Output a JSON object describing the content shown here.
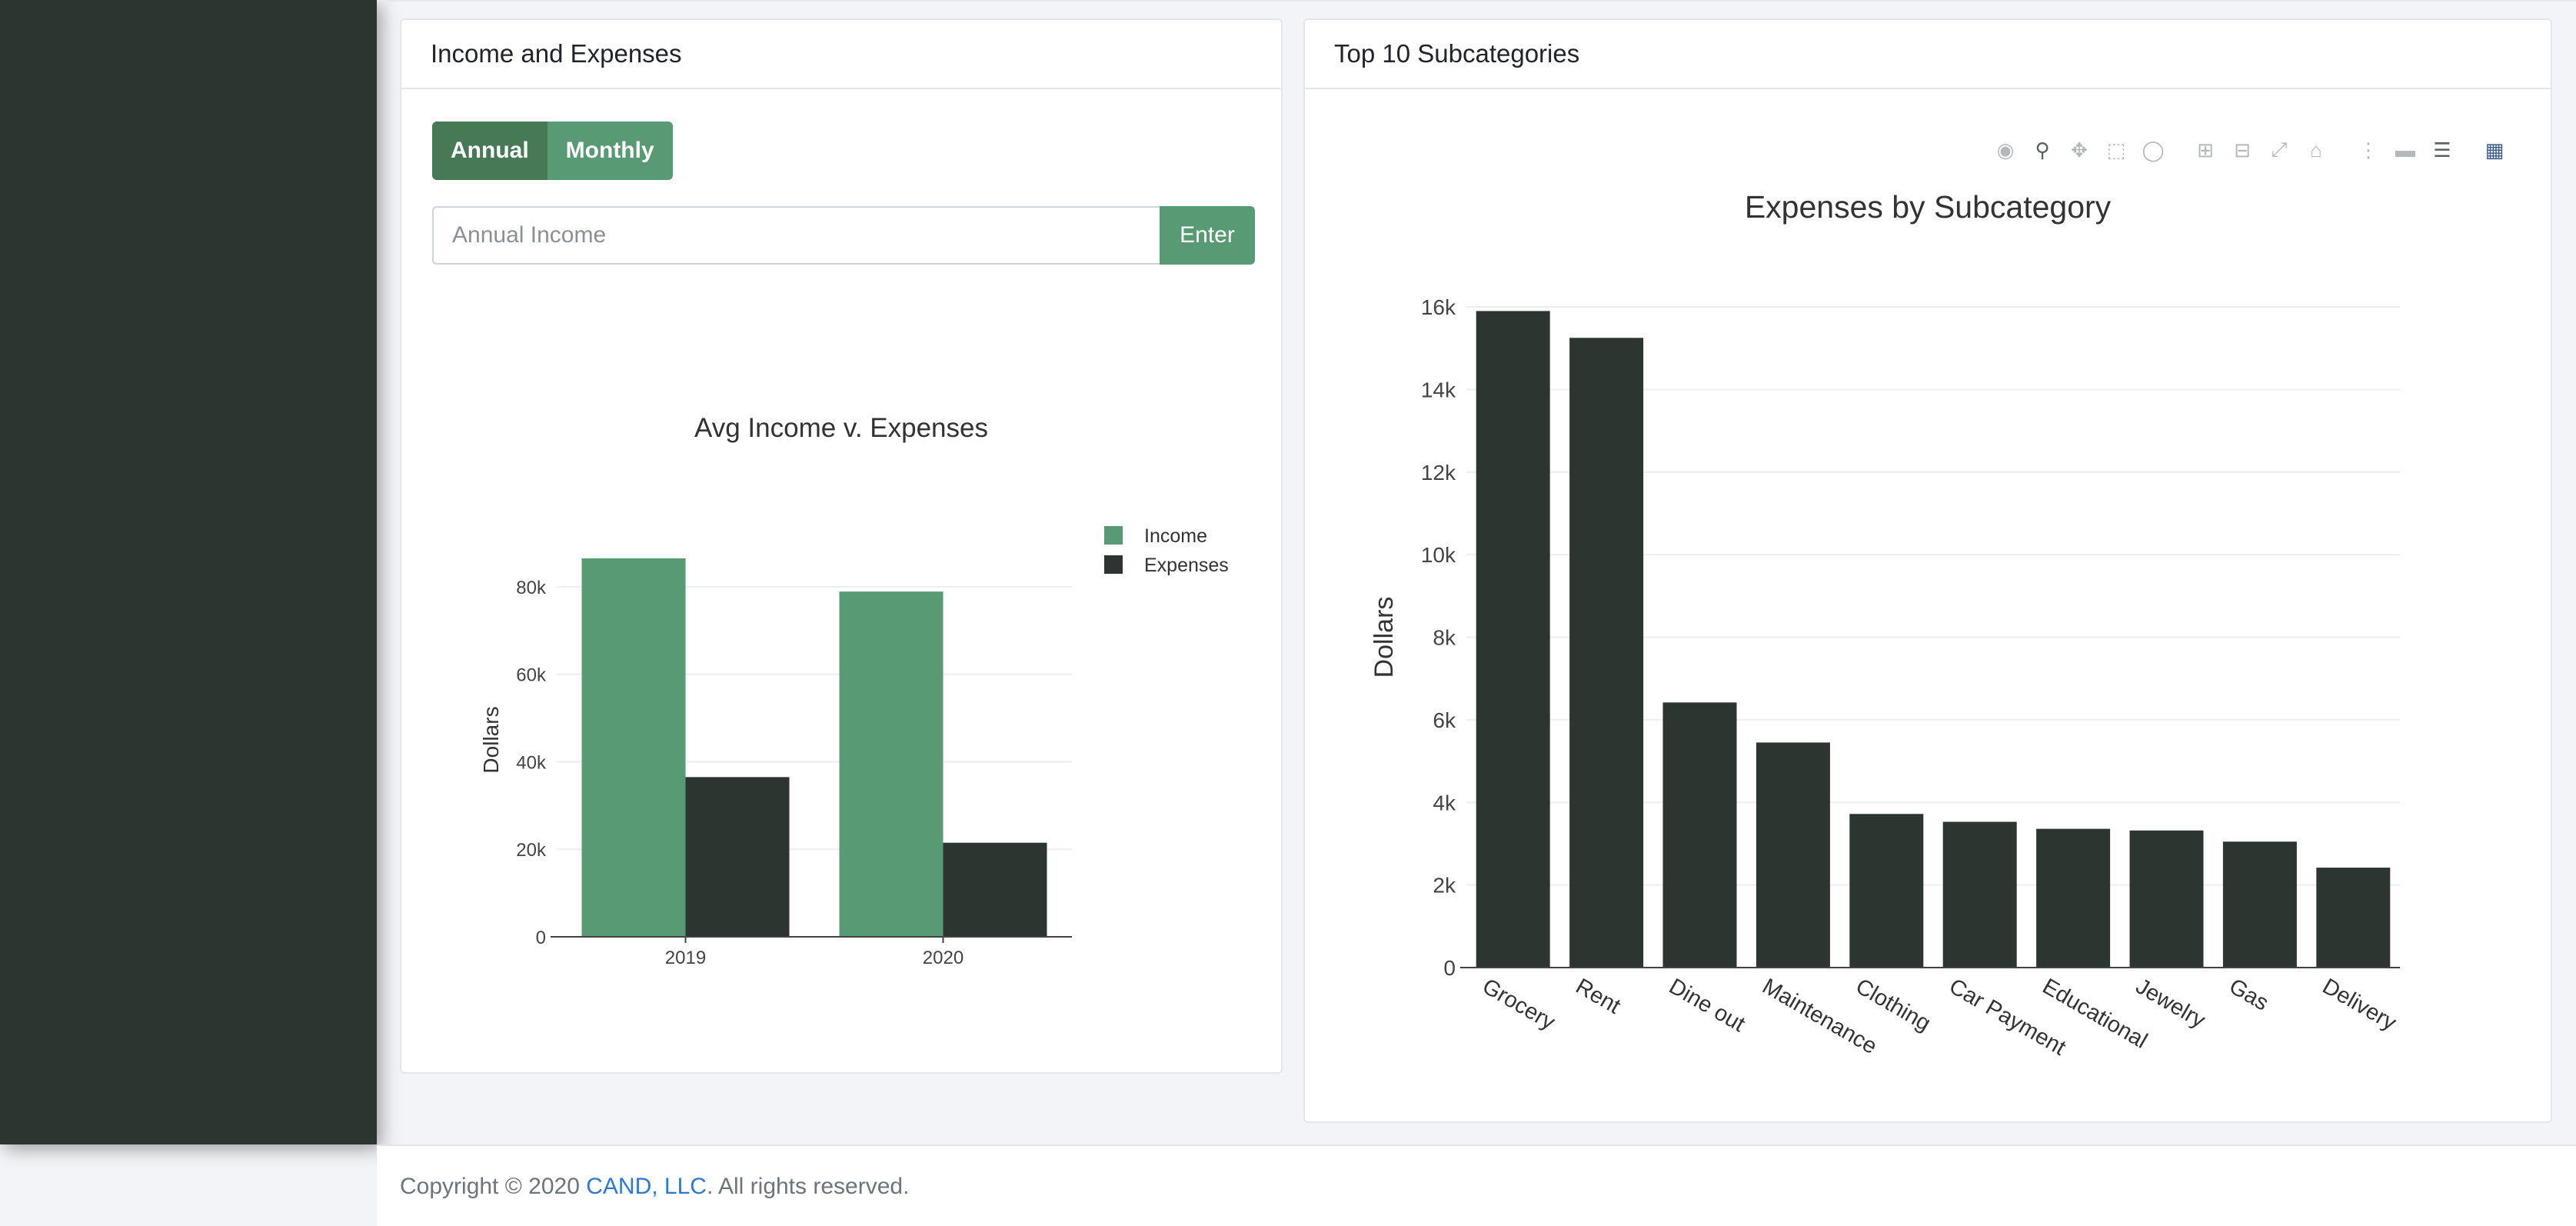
{
  "left_card": {
    "title": "Income and Expenses",
    "annual_label": "Annual",
    "monthly_label": "Monthly",
    "income_placeholder": "Annual Income",
    "enter_label": "Enter"
  },
  "right_card": {
    "title": "Top 10 Subcategories"
  },
  "modebar": {
    "icons": [
      "camera-icon",
      "zoom-icon",
      "pan-icon",
      "box-select-icon",
      "lasso-icon",
      "zoom-in-icon",
      "zoom-out-icon",
      "autoscale-icon",
      "reset-axes-icon",
      "spike-lines-icon",
      "hover-closest-icon",
      "hover-compare-icon",
      "plotly-logo-icon"
    ]
  },
  "footer": {
    "prefix": "Copyright © 2020 ",
    "company": "CAND, LLC",
    "suffix": ". All rights reserved."
  },
  "colors": {
    "sidebar": "#2d3530",
    "income": "#589a74",
    "expenses": "#2d3530",
    "button_dark": "#467a57"
  },
  "chart_data": [
    {
      "type": "bar",
      "title": "Avg Income v. Expenses",
      "xlabel": "",
      "ylabel": "Dollars",
      "categories": [
        "2019",
        "2020"
      ],
      "series": [
        {
          "name": "Income",
          "values": [
            86500,
            78900
          ]
        },
        {
          "name": "Expenses",
          "values": [
            36500,
            21500
          ]
        }
      ],
      "ylim": [
        0,
        90000
      ],
      "yticks": [
        0,
        20000,
        40000,
        60000,
        80000
      ],
      "ytick_labels": [
        "0",
        "20k",
        "40k",
        "60k",
        "80k"
      ],
      "legend": "top-right",
      "grid": true
    },
    {
      "type": "bar",
      "title": "Expenses by Subcategory",
      "xlabel": "",
      "ylabel": "Dollars",
      "categories": [
        "Grocery",
        "Rent",
        "Dine out",
        "Maintenance",
        "Clothing",
        "Car Payment",
        "Educational",
        "Jewelry",
        "Gas",
        "Delivery"
      ],
      "values": [
        15900,
        15250,
        6420,
        5450,
        3720,
        3530,
        3360,
        3320,
        3050,
        2420
      ],
      "ylim": [
        0,
        16000
      ],
      "yticks": [
        0,
        2000,
        4000,
        6000,
        8000,
        10000,
        12000,
        14000,
        16000
      ],
      "ytick_labels": [
        "0",
        "2k",
        "4k",
        "6k",
        "8k",
        "10k",
        "12k",
        "14k",
        "16k"
      ],
      "grid": true
    }
  ]
}
